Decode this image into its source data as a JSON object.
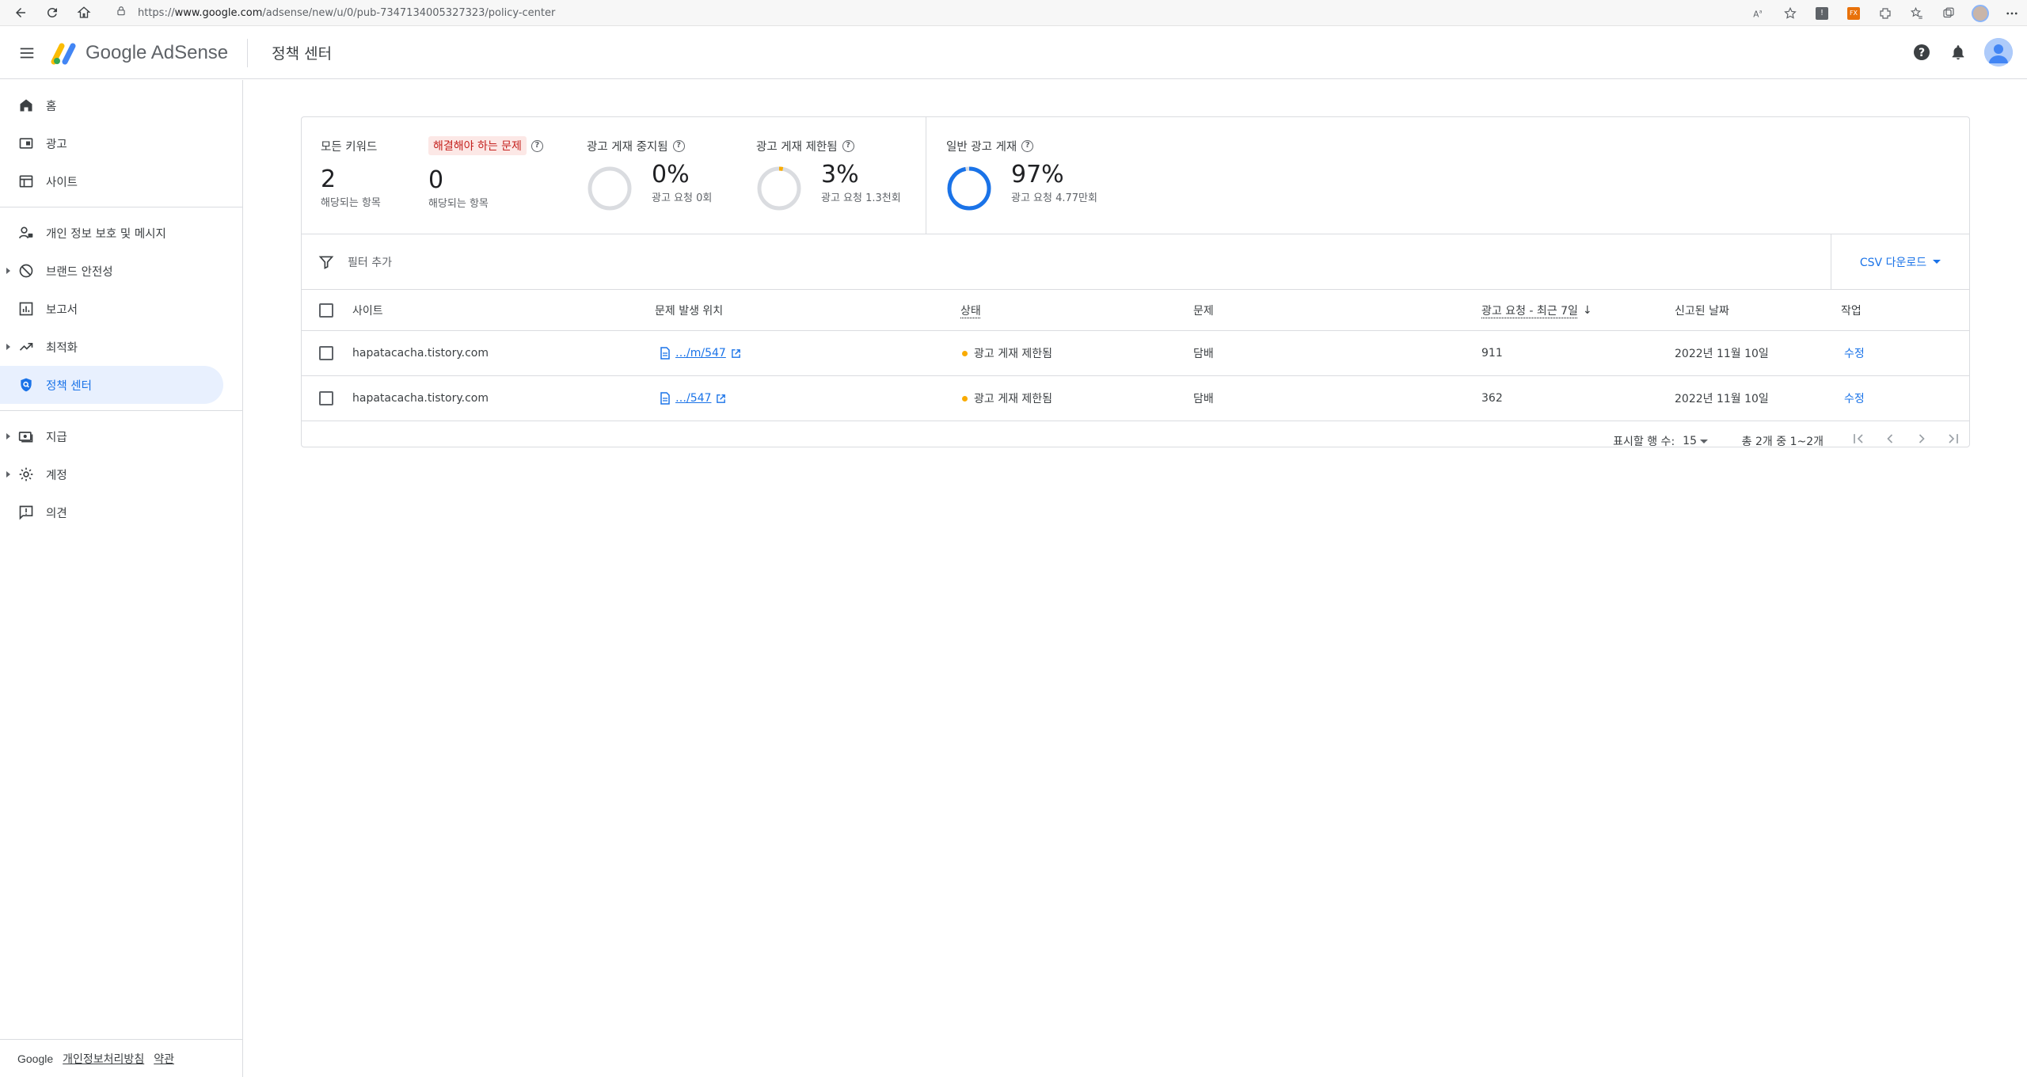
{
  "browser": {
    "url_prefix": "https://",
    "url_host": "www.google.com",
    "url_path": "/adsense/new/u/0/pub-7347134005327323/policy-center"
  },
  "header": {
    "logo_text": "Google AdSense",
    "page_title": "정책 센터"
  },
  "sidebar": {
    "items": [
      {
        "label": "홈",
        "icon": "home-icon"
      },
      {
        "label": "광고",
        "icon": "ads-icon"
      },
      {
        "label": "사이트",
        "icon": "sites-icon"
      },
      {
        "label": "개인 정보 보호 및 메시지",
        "icon": "privacy-icon"
      },
      {
        "label": "브랜드 안전성",
        "icon": "block-icon"
      },
      {
        "label": "보고서",
        "icon": "reports-icon"
      },
      {
        "label": "최적화",
        "icon": "trending-icon"
      },
      {
        "label": "정책 센터",
        "icon": "policy-shield-icon"
      },
      {
        "label": "지급",
        "icon": "payments-icon"
      },
      {
        "label": "계정",
        "icon": "gear-icon"
      },
      {
        "label": "의견",
        "icon": "feedback-icon"
      }
    ],
    "footer": {
      "brand": "Google",
      "privacy": "개인정보처리방침",
      "terms": "약관"
    }
  },
  "summary": {
    "all_keywords": {
      "label": "모든 키워드",
      "value": "2",
      "sub": "해당되는 항목"
    },
    "to_fix": {
      "label": "해결해야 하는 문제",
      "value": "0",
      "sub": "해당되는 항목"
    },
    "stopped": {
      "label": "광고 게재 중지됨",
      "value": "0%",
      "sub": "광고 요청 0회",
      "fraction": 0.0
    },
    "restricted": {
      "label": "광고 게재 제한됨",
      "value": "3%",
      "sub": "광고 요청 1.3천회",
      "fraction": 0.03
    },
    "normal": {
      "label": "일반 광고 게재",
      "value": "97%",
      "sub": "광고 요청 4.77만회",
      "fraction": 0.97
    },
    "colors": {
      "ring_track": "#dadce0",
      "restricted": "#f9ab00",
      "normal": "#1a73e8"
    }
  },
  "filter": {
    "placeholder": "필터 추가",
    "csv_label": "CSV 다운로드"
  },
  "table": {
    "headers": {
      "site": "사이트",
      "location": "문제 발생 위치",
      "status": "상태",
      "issue": "문제",
      "requests": "광고 요청 - 최근 7일",
      "reported": "신고된 날짜",
      "action": "작업"
    },
    "rows": [
      {
        "site": "hapatacacha.tistory.com",
        "location": "…/m/547",
        "status": "광고 게재 제한됨",
        "issue": "담배",
        "requests": "911",
        "reported": "2022년 11월 10일",
        "action": "수정"
      },
      {
        "site": "hapatacacha.tistory.com",
        "location": "…/547",
        "status": "광고 게재 제한됨",
        "issue": "담배",
        "requests": "362",
        "reported": "2022년 11월 10일",
        "action": "수정"
      }
    ]
  },
  "pager": {
    "rows_label": "표시할 행 수:",
    "rows_value": "15",
    "range": "총 2개 중 1~2개"
  }
}
